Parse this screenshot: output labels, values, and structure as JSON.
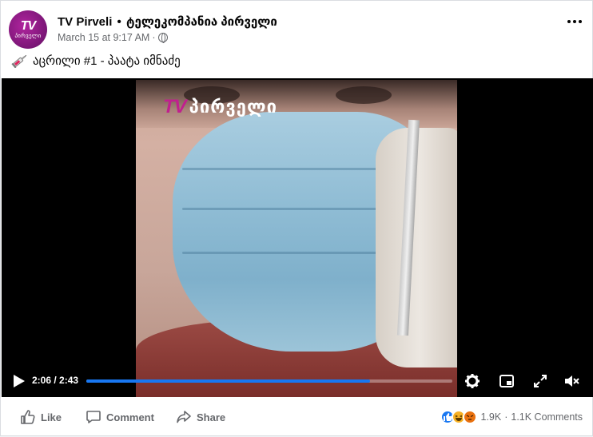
{
  "post": {
    "page_name": "TV Pirveli",
    "page_subtitle": "ტელეკომპანია პირველი",
    "separator": "•",
    "timestamp": "March 15 at 9:17 AM",
    "meta_sep": "·",
    "text": "აცრილი #1 - პაატა იმნაძე",
    "avatar": {
      "logo_top": "TV",
      "logo_bottom": "პირველი"
    }
  },
  "video": {
    "logo_tv": "TV",
    "logo_brand": "პირველი",
    "time": "2:06 / 2:43",
    "progress_fraction": 0.775
  },
  "actions": {
    "like_label": "Like",
    "comment_label": "Comment",
    "share_label": "Share"
  },
  "stats": {
    "reactions_count": "1.9K",
    "sep": "·",
    "comments_count": "1.1K Comments"
  },
  "colors": {
    "accent": "#1877f2",
    "brand": "#c0208e"
  }
}
